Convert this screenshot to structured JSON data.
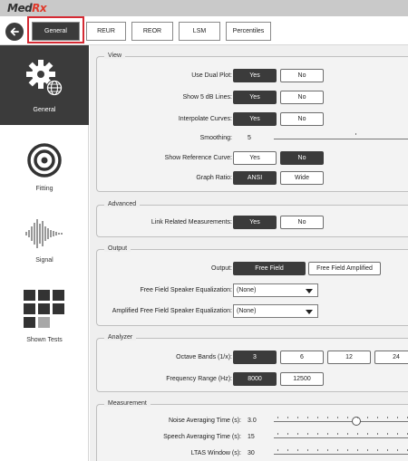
{
  "app": {
    "logo_main": "Med",
    "logo_accent": "Rx"
  },
  "tabs": [
    {
      "label": "General",
      "active": true
    },
    {
      "label": "REUR",
      "active": false
    },
    {
      "label": "REOR",
      "active": false
    },
    {
      "label": "LSM",
      "active": false
    },
    {
      "label": "Percentiles",
      "active": false
    }
  ],
  "sidebar": {
    "items": [
      {
        "label": "General",
        "icon": "gear-globe-icon",
        "active": true
      },
      {
        "label": "Fitting",
        "icon": "target-icon",
        "active": false
      },
      {
        "label": "Signal",
        "icon": "waveform-icon",
        "active": false
      },
      {
        "label": "Shown Tests",
        "icon": "grid-icon",
        "active": false
      }
    ]
  },
  "view": {
    "title": "View",
    "dual_plot": {
      "label": "Use Dual Plot:",
      "yes": "Yes",
      "no": "No",
      "selected": "Yes"
    },
    "show_5db": {
      "label": "Show 5 dB Lines:",
      "yes": "Yes",
      "no": "No",
      "selected": "Yes"
    },
    "interpolate": {
      "label": "Interpolate Curves:",
      "yes": "Yes",
      "no": "No",
      "selected": "Yes"
    },
    "smoothing": {
      "label": "Smoothing:",
      "value": "5"
    },
    "reference_curve": {
      "label": "Show Reference Curve:",
      "yes": "Yes",
      "no": "No",
      "selected": "No"
    },
    "graph_ratio": {
      "label": "Graph Ratio:",
      "option1": "ANSI",
      "option2": "Wide",
      "selected": "ANSI"
    }
  },
  "advanced": {
    "title": "Advanced",
    "link_related": {
      "label": "Link Related Measurements:",
      "yes": "Yes",
      "no": "No",
      "selected": "Yes"
    }
  },
  "output": {
    "title": "Output",
    "output": {
      "label": "Output:",
      "option1": "Free Field",
      "option2": "Free Field Amplified",
      "selected": "Free Field"
    },
    "ff_eq": {
      "label": "Free Field Speaker Equalization:",
      "value": "(None)"
    },
    "aff_eq": {
      "label": "Amplified Free Field Speaker Equalization:",
      "value": "(None)"
    }
  },
  "analyzer": {
    "title": "Analyzer",
    "octave_bands": {
      "label": "Octave Bands (1/x):",
      "options": [
        "3",
        "6",
        "12",
        "24"
      ],
      "selected": "3"
    },
    "freq_range": {
      "label": "Frequency Range (Hz):",
      "option1": "8000",
      "option2": "12500",
      "selected": "8000"
    }
  },
  "measurement": {
    "title": "Measurement",
    "noise_avg": {
      "label": "Noise Averaging Time (s):",
      "value": "3.0"
    },
    "speech_avg": {
      "label": "Speech Averaging Time (s):",
      "value": "15"
    },
    "ltas": {
      "label": "LTAS Window (s):",
      "value": "30"
    }
  }
}
